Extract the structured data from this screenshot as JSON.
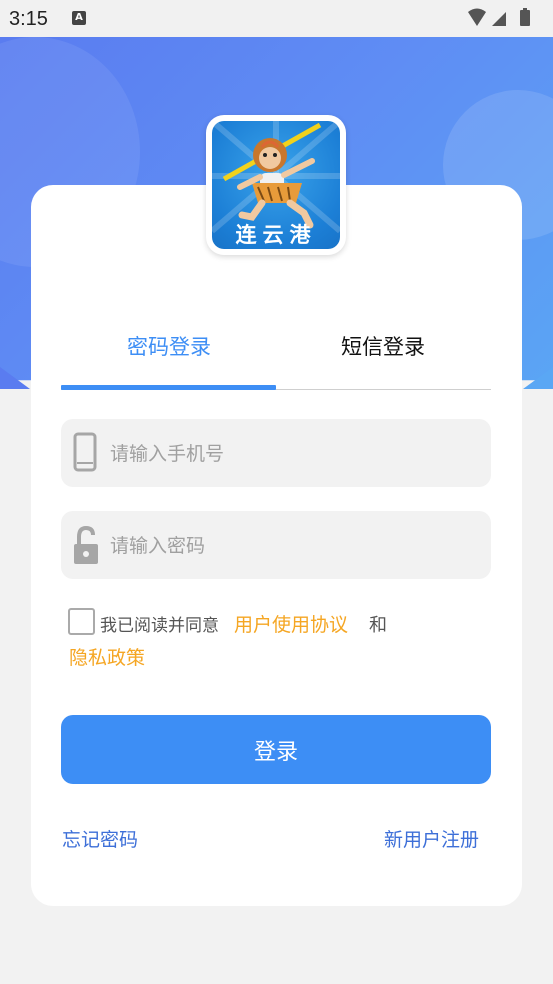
{
  "status_bar": {
    "time": "3:15",
    "notification_icon": "a-icon"
  },
  "tabs": [
    {
      "label": "密码登录",
      "active": true
    },
    {
      "label": "短信登录",
      "active": false
    }
  ],
  "form": {
    "phone_placeholder": "请输入手机号",
    "password_placeholder": "请输入密码"
  },
  "agreement": {
    "prefix": "我已阅读并同意",
    "user_agreement": "用户使用协议",
    "conjunction": "和",
    "privacy_policy": "隐私政策"
  },
  "login_button": "登录",
  "links": {
    "forgot_password": "忘记密码",
    "register": "新用户注册"
  },
  "logo_text": "连云港",
  "colors": {
    "primary": "#3d8ef5",
    "link_orange": "#f5a623",
    "header_blue": "#5f8df4"
  }
}
